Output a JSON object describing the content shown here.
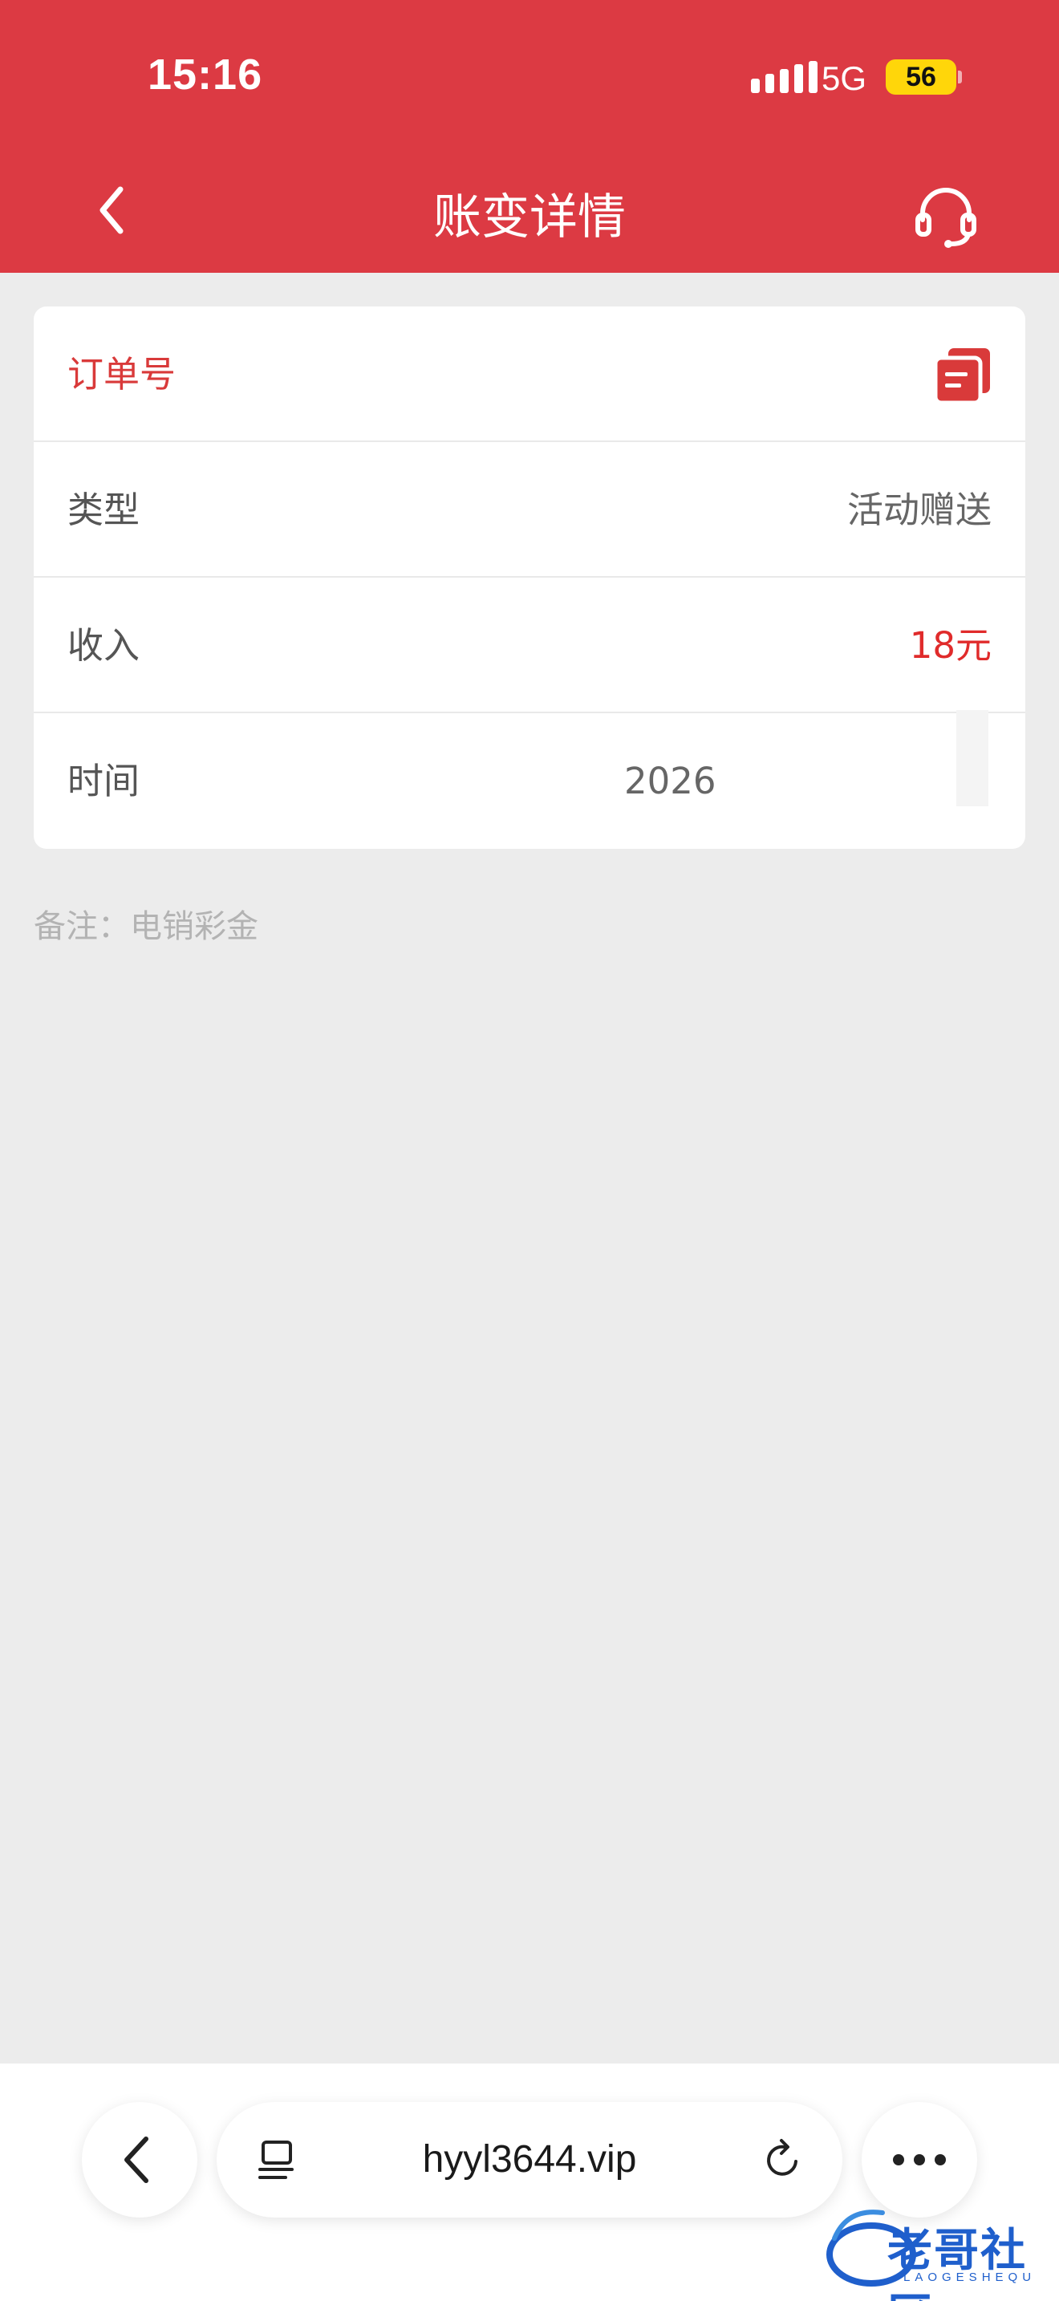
{
  "status_bar": {
    "time": "15:16",
    "network": "5G",
    "battery": "56"
  },
  "header": {
    "title": "账变详情",
    "back_icon": "chevron-left-icon",
    "support_icon": "headset-icon"
  },
  "details": {
    "order_label": "订单号",
    "copy_icon": "copy-icon",
    "type_label": "类型",
    "type_value": "活动赠送",
    "income_label": "收入",
    "income_value": "18元",
    "time_label": "时间",
    "time_value": "2026"
  },
  "remark": "备注：电销彩金",
  "browser": {
    "url": "hyyl3644.vip",
    "back_icon": "chevron-left-icon",
    "tabs_icon": "tabs-icon",
    "reload_icon": "reload-icon",
    "more_icon": "more-icon"
  },
  "watermark": {
    "text": "老哥社区",
    "sub": "LAOGESHEQU"
  },
  "colors": {
    "brand_red": "#dc3a43",
    "income_red": "#e02b2b",
    "background": "#ececec"
  }
}
